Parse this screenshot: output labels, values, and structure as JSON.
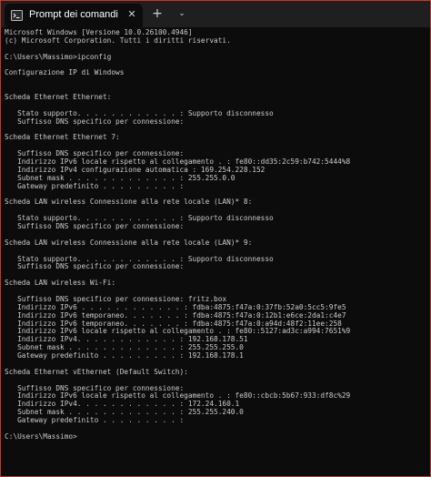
{
  "window": {
    "tab_title": "Prompt dei comandi",
    "close_glyph": "✕",
    "new_tab_glyph": "+",
    "dropdown_glyph": "⌄",
    "tab_icon": "terminal-icon"
  },
  "colors": {
    "background": "#0c0c0c",
    "text": "#cccccc",
    "tabbar": "#1f1f1f",
    "border": "#c0392b"
  },
  "console": {
    "lines": [
      "Microsoft Windows [Versione 10.0.26100.4946]",
      "(c) Microsoft Corporation. Tutti i diritti riservati.",
      "",
      "C:\\Users\\Massimo>ipconfig",
      "",
      "Configurazione IP di Windows",
      "",
      "",
      "Scheda Ethernet Ethernet:",
      "",
      "   Stato supporto. . . . . . . . . . . . : Supporto disconnesso",
      "   Suffisso DNS specifico per connessione:",
      "",
      "Scheda Ethernet Ethernet 7:",
      "",
      "   Suffisso DNS specifico per connessione:",
      "   Indirizzo IPv6 locale rispetto al collegamento . : fe80::dd35:2c59:b742:5444%8",
      "   Indirizzo IPv4 configurazione automatica : 169.254.228.152",
      "   Subnet mask . . . . . . . . . . . . . : 255.255.0.0",
      "   Gateway predefinito . . . . . . . . . :",
      "",
      "Scheda LAN wireless Connessione alla rete locale (LAN)* 8:",
      "",
      "   Stato supporto. . . . . . . . . . . . : Supporto disconnesso",
      "   Suffisso DNS specifico per connessione:",
      "",
      "Scheda LAN wireless Connessione alla rete locale (LAN)* 9:",
      "",
      "   Stato supporto. . . . . . . . . . . . : Supporto disconnesso",
      "   Suffisso DNS specifico per connessione:",
      "",
      "Scheda LAN wireless Wi-Fi:",
      "",
      "   Suffisso DNS specifico per connessione: fritz.box",
      "   Indirizzo IPv6 . . . . . . . . . . . . : fdba:4875:f47a:0:37fb:52a0:5cc5:9fe5",
      "   Indirizzo IPv6 temporaneo. . . . . . . : fdba:4875:f47a:0:12b1:e6ce:2da1:c4e7",
      "   Indirizzo IPv6 temporaneo. . . . . . . : fdba:4875:f47a:0:a94d:48f2:11ee:258",
      "   Indirizzo IPv6 locale rispetto al collegamento . : fe80::5127:ad3c:a994:7651%9",
      "   Indirizzo IPv4. . . . . . . . . . . . : 192.168.178.51",
      "   Subnet mask . . . . . . . . . . . . . : 255.255.255.0",
      "   Gateway predefinito . . . . . . . . . : 192.168.178.1",
      "",
      "Scheda Ethernet vEthernet (Default Switch):",
      "",
      "   Suffisso DNS specifico per connessione:",
      "   Indirizzo IPv6 locale rispetto al collegamento . : fe80::cbcb:5b67:933:df8c%29",
      "   Indirizzo IPv4. . . . . . . . . . . . : 172.24.160.1",
      "   Subnet mask . . . . . . . . . . . . . : 255.255.240.0",
      "   Gateway predefinito . . . . . . . . . :",
      "",
      "C:\\Users\\Massimo>"
    ]
  }
}
